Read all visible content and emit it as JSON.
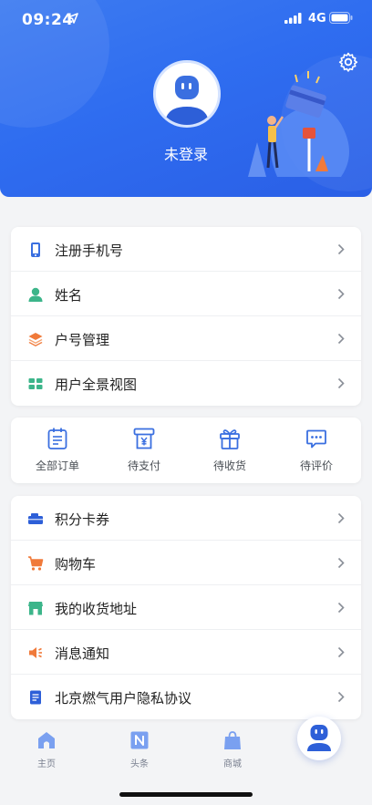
{
  "status_bar": {
    "time": "09:24",
    "network": "4G"
  },
  "profile": {
    "login_text": "未登录"
  },
  "account_menu": [
    {
      "label": "注册手机号",
      "icon": "phone-icon"
    },
    {
      "label": "姓名",
      "icon": "person-icon"
    },
    {
      "label": "户号管理",
      "icon": "layers-icon"
    },
    {
      "label": "用户全景视图",
      "icon": "grid-icon"
    }
  ],
  "orders": [
    {
      "label": "全部订单",
      "icon": "order-list-icon"
    },
    {
      "label": "待支付",
      "icon": "payment-icon"
    },
    {
      "label": "待收货",
      "icon": "gift-box-icon"
    },
    {
      "label": "待评价",
      "icon": "comment-icon"
    }
  ],
  "service_menu": [
    {
      "label": "积分卡券",
      "icon": "coupon-icon"
    },
    {
      "label": "购物车",
      "icon": "cart-icon"
    },
    {
      "label": "我的收货地址",
      "icon": "store-icon"
    },
    {
      "label": "消息通知",
      "icon": "speaker-icon"
    },
    {
      "label": "北京燃气用户隐私协议",
      "icon": "document-icon"
    }
  ],
  "tabbar": {
    "home": "主页",
    "news": "头条",
    "mall": "商城"
  },
  "colors": {
    "header": "#2f6df0",
    "accent_blue": "#3a6fe0",
    "accent_orange": "#f07a3a",
    "accent_green": "#3cb58a"
  }
}
